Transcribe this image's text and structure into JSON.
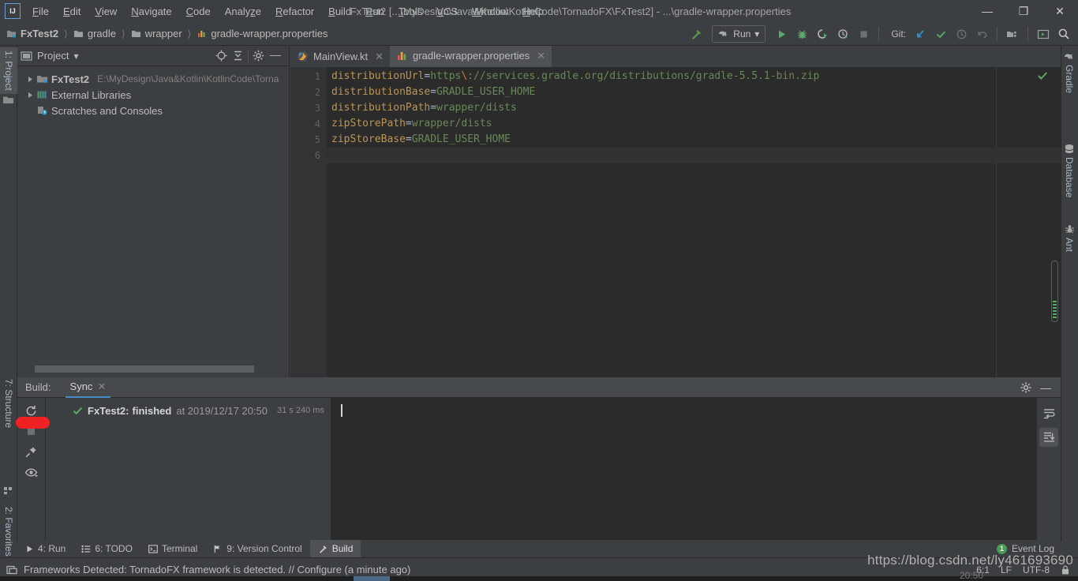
{
  "window": {
    "title": "FxTest2 [...\\MyDesign\\Java&Kotlin\\KotlinCode\\TornadoFX\\FxTest2] - ...\\gradle-wrapper.properties",
    "logo": "IJ",
    "minimize": "—",
    "maximize": "❐",
    "close": "✕"
  },
  "menu": [
    {
      "label": "File"
    },
    {
      "label": "Edit"
    },
    {
      "label": "View"
    },
    {
      "label": "Navigate"
    },
    {
      "label": "Code"
    },
    {
      "label": "Analyze"
    },
    {
      "label": "Refactor"
    },
    {
      "label": "Build"
    },
    {
      "label": "Run"
    },
    {
      "label": "Tools"
    },
    {
      "label": "VCS"
    },
    {
      "label": "Window"
    },
    {
      "label": "Help"
    }
  ],
  "breadcrumbs": [
    {
      "label": "FxTest2",
      "icon": "module-icon"
    },
    {
      "label": "gradle",
      "icon": "folder-icon"
    },
    {
      "label": "wrapper",
      "icon": "folder-icon"
    },
    {
      "label": "gradle-wrapper.properties",
      "icon": "properties-file-icon"
    }
  ],
  "toolbar": {
    "build_icon": "hammer-icon",
    "run_config": "Run",
    "run_config_icon": "gradle-elephant-icon",
    "chevron": "▾",
    "buttons": [
      {
        "name": "run-button",
        "icon": "play-icon"
      },
      {
        "name": "debug-button",
        "icon": "bug-icon"
      },
      {
        "name": "run-with-coverage-button",
        "icon": "coverage-icon"
      },
      {
        "name": "profile-button",
        "icon": "profiler-icon"
      },
      {
        "name": "stop-button",
        "icon": "stop-icon"
      }
    ],
    "git_label": "Git:",
    "git_buttons": [
      {
        "name": "update-project-button",
        "icon": "update-arrow-icon"
      },
      {
        "name": "commit-button",
        "icon": "check-icon"
      },
      {
        "name": "history-button",
        "icon": "clock-icon"
      },
      {
        "name": "rollback-button",
        "icon": "undo-icon"
      }
    ],
    "right_buttons": [
      {
        "name": "project-structure-button",
        "icon": "project-structure-icon"
      },
      {
        "name": "settings-button",
        "icon": "ide-settings-icon"
      },
      {
        "name": "search-everywhere-button",
        "icon": "search-icon"
      }
    ]
  },
  "left_strip": [
    {
      "label": "1: Project",
      "key": "1",
      "active": true
    },
    {
      "label": "7: Structure",
      "key": "7",
      "active": false
    },
    {
      "label": "2: Favorites",
      "key": "2",
      "active": false
    }
  ],
  "right_strip": [
    {
      "label": "Gradle",
      "icon": "gradle-elephant-icon"
    },
    {
      "label": "Database",
      "icon": "database-icon"
    },
    {
      "label": "Ant",
      "icon": "ant-icon"
    }
  ],
  "project_panel": {
    "title": "Project",
    "chevron": "▾",
    "view_icon": "project-view-icon",
    "tools": [
      {
        "name": "scroll-from-source-button",
        "icon": "crosshair-icon"
      },
      {
        "name": "collapse-all-button",
        "icon": "collapse-all-icon"
      },
      {
        "name": "panel-settings-button",
        "icon": "gear-icon"
      },
      {
        "name": "hide-panel-button",
        "icon": "minimize-icon"
      }
    ],
    "tree": [
      {
        "label": "FxTest2",
        "path": "E:\\MyDesign\\Java&Kotlin\\KotlinCode\\Torna",
        "icon": "module-icon",
        "expandable": true,
        "bold": true
      },
      {
        "label": "External Libraries",
        "path": "",
        "icon": "libraries-icon",
        "expandable": true,
        "bold": false
      },
      {
        "label": "Scratches and Consoles",
        "path": "",
        "icon": "scratches-icon",
        "expandable": false,
        "bold": false
      }
    ]
  },
  "editor": {
    "tabs": [
      {
        "label": "MainView.kt",
        "icon": "kotlin-file-icon",
        "active": false,
        "close": "✕"
      },
      {
        "label": "gradle-wrapper.properties",
        "icon": "properties-file-icon",
        "active": true,
        "close": "✕"
      }
    ],
    "line_numbers": [
      "1",
      "2",
      "3",
      "4",
      "5",
      "6"
    ],
    "lines": [
      {
        "key": "distributionUrl",
        "eq": "=",
        "value_pre": "https",
        "escape": "\\",
        "value_post": "://services.gradle.org/distributions/gradle-5.5.1-bin.zip",
        "current": false
      },
      {
        "key": "distributionBase",
        "eq": "=",
        "value_pre": "GRADLE_USER_HOME",
        "escape": "",
        "value_post": "",
        "current": false
      },
      {
        "key": "distributionPath",
        "eq": "=",
        "value_pre": "wrapper/dists",
        "escape": "",
        "value_post": "",
        "current": false
      },
      {
        "key": "zipStorePath",
        "eq": "=",
        "value_pre": "wrapper/dists",
        "escape": "",
        "value_post": "",
        "current": false
      },
      {
        "key": "zipStoreBase",
        "eq": "=",
        "value_pre": "GRADLE_USER_HOME",
        "escape": "",
        "value_post": "",
        "current": false
      },
      {
        "key": "",
        "eq": "",
        "value_pre": "",
        "escape": "",
        "value_post": "",
        "current": true
      }
    ],
    "inspection_status": "ok-check-icon"
  },
  "build_panel": {
    "label": "Build:",
    "tab": "Sync",
    "tab_close": "✕",
    "header_tools": [
      {
        "name": "build-settings-button",
        "icon": "gear-icon"
      },
      {
        "name": "hide-build-panel-button",
        "icon": "minimize-icon"
      }
    ],
    "toolbar": [
      {
        "name": "rerun-sync-button",
        "icon": "refresh-icon"
      },
      {
        "name": "stop-build-button",
        "icon": "stop-icon"
      },
      {
        "name": "pin-tab-button",
        "icon": "pin-icon"
      },
      {
        "name": "toggle-view-button",
        "icon": "eye-icon"
      }
    ],
    "tree_item": {
      "status_icon": "green-check-icon",
      "name": "FxTest2:",
      "state": "finished",
      "at": "at 2019/12/17 20:50",
      "duration": "31 s 240 ms"
    },
    "console_tools": [
      {
        "name": "soft-wrap-button",
        "icon": "soft-wrap-icon"
      },
      {
        "name": "scroll-to-end-button",
        "icon": "scroll-to-end-icon"
      }
    ]
  },
  "bottom_bar": {
    "items": [
      {
        "label": "4: Run",
        "key": "4",
        "icon": "play-icon",
        "active": false
      },
      {
        "label": "6: TODO",
        "key": "6",
        "icon": "todo-icon",
        "active": false
      },
      {
        "label": "Terminal",
        "key": "",
        "icon": "terminal-icon",
        "active": false
      },
      {
        "label": "9: Version Control",
        "key": "9",
        "icon": "branch-icon",
        "active": false
      },
      {
        "label": "Build",
        "key": "",
        "icon": "hammer-icon",
        "active": true
      }
    ],
    "event_log": {
      "label": "Event Log",
      "badge": "1"
    }
  },
  "status_bar": {
    "icon": "frameworks-icon",
    "message": "Frameworks Detected: TornadoFX framework is detected. // Configure (a minute ago)",
    "caret": "6:1",
    "line_separator": "LF",
    "encoding": "UTF-8",
    "lock_icon": "lock-icon"
  },
  "watermark": {
    "url": "https://blog.csdn.net/ly461693690",
    "sub": "20:50"
  },
  "colors": {
    "background": "#3c3f41",
    "editor_bg": "#2b2b2b",
    "accent_blue": "#4a88c7",
    "green": "#59a869",
    "key_orange": "#bc9458",
    "value_green": "#6a8759",
    "annotation_red": "#ee2222"
  }
}
